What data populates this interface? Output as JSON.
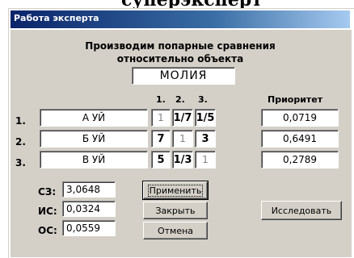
{
  "window": {
    "title": "Работа эксперта"
  },
  "heading": {
    "line1": "Производим попарные сравнения",
    "line2": "относительно объекта"
  },
  "object_name": "МОЛИЯ",
  "columns": {
    "c1": "1.",
    "c2": "2.",
    "c3": "3.",
    "priority": "Приоритет"
  },
  "rows": [
    {
      "num": "1.",
      "name": "А УЙ",
      "v1": "1",
      "v2": "1/7",
      "v3": "1/5",
      "priority": "0,0719"
    },
    {
      "num": "2.",
      "name": "Б УЙ",
      "v1": "7",
      "v2": "1",
      "v3": "3",
      "priority": "0,6491"
    },
    {
      "num": "3.",
      "name": "В УЙ",
      "v1": "5",
      "v2": "1/3",
      "v3": "1",
      "priority": "0,2789"
    }
  ],
  "stats": [
    {
      "label": "СЗ:",
      "value": "3,0648"
    },
    {
      "label": "ИС:",
      "value": "0,0324"
    },
    {
      "label": "ОС:",
      "value": "0,0559"
    }
  ],
  "buttons": {
    "apply": "Применить",
    "close": "Закрыть",
    "cancel": "Отмена",
    "investigate": "Исследовать"
  },
  "top_strip_text": "суперэксперт"
}
